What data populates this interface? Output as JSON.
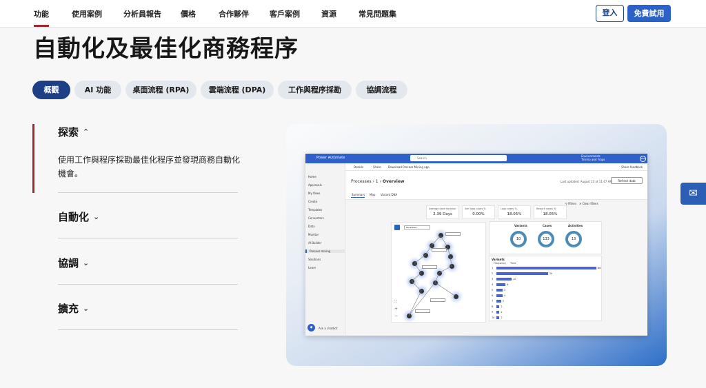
{
  "nav": {
    "items": [
      "功能",
      "使用案例",
      "分析員報告",
      "價格",
      "合作夥伴",
      "客戶案例",
      "資源",
      "常見問題集"
    ],
    "login": "登入",
    "trial": "免費試用"
  },
  "hero_title": "自動化及最佳化商務程序",
  "pills": [
    "概觀",
    "AI 功能",
    "桌面流程 (RPA)",
    "雲端流程 (DPA)",
    "工作與程序採勘",
    "協調流程"
  ],
  "accordion": [
    {
      "title": "探索",
      "chevron": "⌃",
      "body": "使用工作與程序採勘最佳化程序並發現商務自動化機會。"
    },
    {
      "title": "自動化",
      "chevron": "⌄"
    },
    {
      "title": "協調",
      "chevron": "⌄"
    },
    {
      "title": "擴充",
      "chevron": "⌄"
    }
  ],
  "mail_icon": "✉",
  "app": {
    "brand": "Power Automate",
    "search": "Search",
    "env": "Environments\nTimmo and Fraps",
    "avatar": "MM",
    "side": [
      "Home",
      "Approvals",
      "My flows",
      "Create",
      "Templates",
      "Connectors",
      "Data",
      "Monitor",
      "AI Builder",
      "Process mining",
      "Solutions",
      "Learn"
    ],
    "bot_label": "Ask a chatbot",
    "cmd": [
      "Details",
      "Share",
      "Download Process Mining app",
      "Share feedback"
    ],
    "crumb_a": "Processes",
    "crumb_b": "1",
    "crumb_c": "Overview",
    "updated": "Last updated: August 23 at 11:47 AM",
    "refresh": "Refresh data",
    "tabs": [
      "Summary",
      "Map",
      "Variant DNA"
    ],
    "filters": "Filters",
    "clear_filters": "Clear filters",
    "kpis": [
      {
        "label": "Average case duration",
        "value": "2.39 Days"
      },
      {
        "label": "Self loop cases %",
        "value": "0.00%"
      },
      {
        "label": "Loop cases %",
        "value": "18.05%"
      },
      {
        "label": "Rework cases %",
        "value": "18.05%"
      }
    ],
    "stats": [
      {
        "label": "Variants",
        "value": "10"
      },
      {
        "label": "Cases",
        "value": "133"
      },
      {
        "label": "Activities",
        "value": "13"
      }
    ],
    "variants_title": "Variants",
    "variants_tabs": [
      "Frequency",
      "Time"
    ],
    "variant_bars": [
      {
        "label": "1",
        "value": 66
      },
      {
        "label": "2",
        "value": 34
      },
      {
        "label": "3",
        "value": 10
      },
      {
        "label": "4",
        "value": 6
      },
      {
        "label": "5",
        "value": 4
      },
      {
        "label": "6",
        "value": 4
      },
      {
        "label": "7",
        "value": 3
      },
      {
        "label": "8",
        "value": 2
      },
      {
        "label": "9",
        "value": 2
      },
      {
        "label": "10",
        "value": 2
      }
    ],
    "map_dropdown": "Workflows"
  }
}
